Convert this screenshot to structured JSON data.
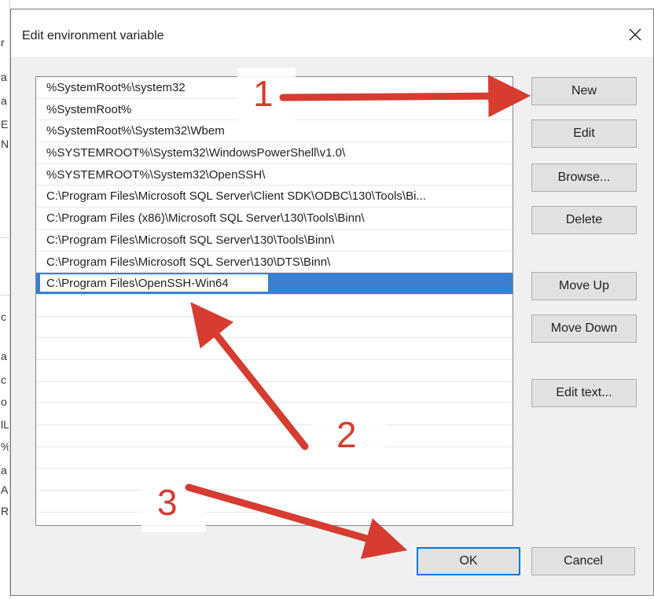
{
  "background": {
    "fragments": [
      "r",
      "a",
      "a",
      "E",
      "N",
      "c",
      "a",
      "c",
      "o",
      "lL",
      "%",
      "a",
      "A",
      "R"
    ]
  },
  "dialog": {
    "title": "Edit environment variable",
    "close_glyph": "✕",
    "paths": [
      "%SystemRoot%\\system32",
      "%SystemRoot%",
      "%SystemRoot%\\System32\\Wbem",
      "%SYSTEMROOT%\\System32\\WindowsPowerShell\\v1.0\\",
      "%SYSTEMROOT%\\System32\\OpenSSH\\",
      "C:\\Program Files\\Microsoft SQL Server\\Client SDK\\ODBC\\130\\Tools\\Bi...",
      "C:\\Program Files (x86)\\Microsoft SQL Server\\130\\Tools\\Binn\\",
      "C:\\Program Files\\Microsoft SQL Server\\130\\Tools\\Binn\\",
      "C:\\Program Files\\Microsoft SQL Server\\130\\DTS\\Binn\\"
    ],
    "editing_value": "C:\\Program Files\\OpenSSH-Win64",
    "buttons": {
      "new": "New",
      "edit": "Edit",
      "browse": "Browse...",
      "delete": "Delete",
      "move_up": "Move Up",
      "move_down": "Move Down",
      "edit_text": "Edit text...",
      "ok": "OK",
      "cancel": "Cancel"
    }
  },
  "annotations": {
    "step1": "1",
    "step2": "2",
    "step3": "3",
    "arrow_color": "#d63c30"
  }
}
